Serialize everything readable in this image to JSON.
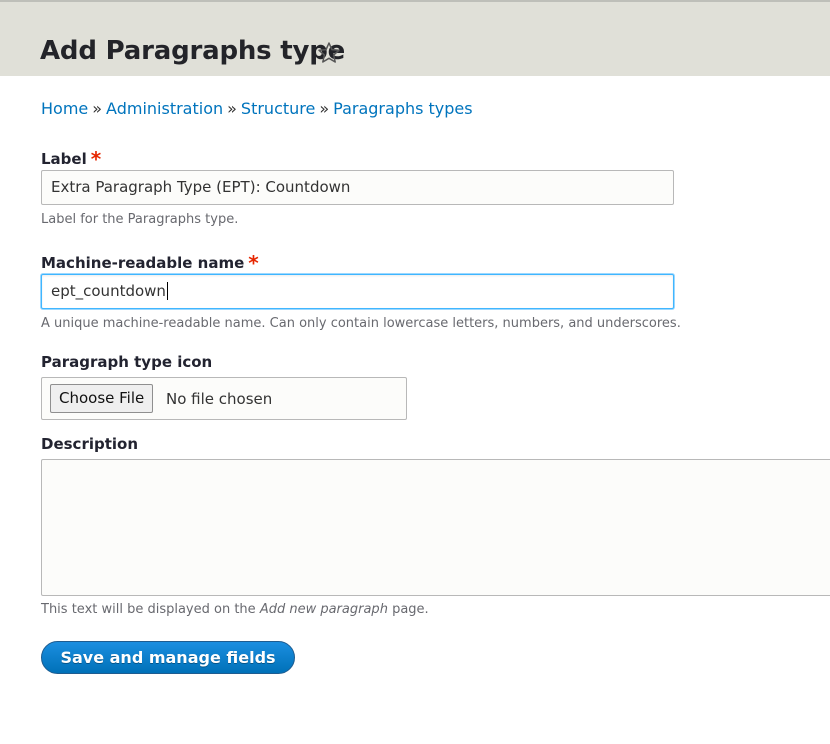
{
  "header": {
    "title": "Add Paragraphs type",
    "star_icon": "star-outline-icon"
  },
  "breadcrumb": {
    "items": [
      "Home",
      "Administration",
      "Structure",
      "Paragraphs types"
    ],
    "separator": "»"
  },
  "form": {
    "label_field": {
      "label": "Label",
      "required_mark": "*",
      "value": "Extra Paragraph Type (EPT): Countdown",
      "description": "Label for the Paragraphs type."
    },
    "machine_name_field": {
      "label": "Machine-readable name",
      "required_mark": "*",
      "value": "ept_countdown",
      "description": "A unique machine-readable name. Can only contain lowercase letters, numbers, and underscores."
    },
    "icon_field": {
      "label": "Paragraph type icon",
      "button_label": "Choose File",
      "status": "No file chosen"
    },
    "description_field": {
      "label": "Description",
      "value": "",
      "help_prefix": "This text will be displayed on the ",
      "help_emphasis": "Add new paragraph",
      "help_suffix": " page."
    },
    "submit_label": "Save and manage fields"
  },
  "colors": {
    "header_bg": "#e0e0d8",
    "link": "#0074bd",
    "required": "#e62600",
    "primary_button": "#0071b8",
    "focus_border": "#40b6ff"
  }
}
